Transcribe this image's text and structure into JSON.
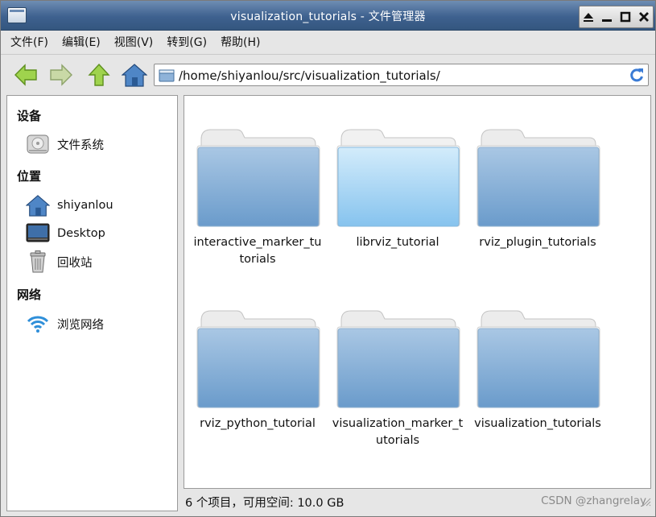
{
  "window": {
    "title": "visualization_tutorials - 文件管理器"
  },
  "menu": [
    "文件(F)",
    "编辑(E)",
    "视图(V)",
    "转到(G)",
    "帮助(H)"
  ],
  "toolbar": {
    "back_icon": "arrow-left-icon",
    "forward_icon": "arrow-right-icon",
    "up_icon": "arrow-up-icon",
    "home_icon": "home-icon",
    "address": "/home/shiyanlou/src/visualization_tutorials/",
    "refresh_icon": "refresh-icon"
  },
  "sidebar": {
    "devices_heading": "设备",
    "devices": [
      {
        "label": "文件系统",
        "icon": "drive-icon"
      }
    ],
    "places_heading": "位置",
    "places": [
      {
        "label": "shiyanlou",
        "icon": "home-icon"
      },
      {
        "label": "Desktop",
        "icon": "desktop-icon"
      },
      {
        "label": "回收站",
        "icon": "trash-icon"
      }
    ],
    "network_heading": "网络",
    "network": [
      {
        "label": "浏览网络",
        "icon": "wifi-icon"
      }
    ]
  },
  "folders": [
    {
      "name": "interactive_marker_tutorials",
      "selected": false
    },
    {
      "name": "librviz_tutorial",
      "selected": true
    },
    {
      "name": "rviz_plugin_tutorials",
      "selected": false
    },
    {
      "name": "rviz_python_tutorial",
      "selected": false
    },
    {
      "name": "visualization_marker_tutorials",
      "selected": false
    },
    {
      "name": "visualization_tutorials",
      "selected": false
    }
  ],
  "status": {
    "text": "6 个项目，可用空间: 10.0 GB",
    "watermark": "CSDN @zhangrelay"
  },
  "colors": {
    "titlebar": "#3e618f",
    "folder": "#7aa6d1",
    "folder_selected": "#a9d6f5",
    "nav_arrow": "#8ac43c"
  }
}
